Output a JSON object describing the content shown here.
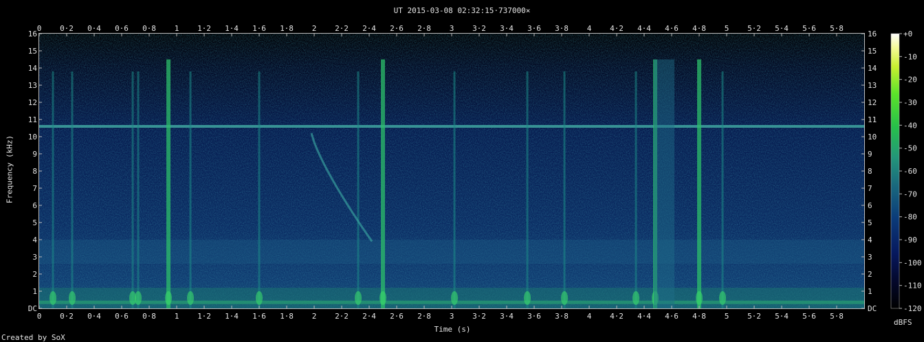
{
  "chart_data": {
    "type": "heatmap",
    "title": "UT 2015-03-08 02:32:15·737000×",
    "xlabel": "Time (s)",
    "ylabel": "Frequency (kHz)",
    "xlim": [
      0,
      6
    ],
    "ylim": [
      0,
      16
    ],
    "x_ticks": [
      "0",
      "0·2",
      "0·4",
      "0·6",
      "0·8",
      "1",
      "1·2",
      "1·4",
      "1·6",
      "1·8",
      "2",
      "2·2",
      "2·4",
      "2·6",
      "2·8",
      "3",
      "3·2",
      "3·4",
      "3·6",
      "3·8",
      "4",
      "4·2",
      "4·4",
      "4·6",
      "4·8",
      "5",
      "5·2",
      "5·4",
      "5·6",
      "5·8"
    ],
    "y_ticks": [
      "DC",
      "1",
      "2",
      "3",
      "4",
      "5",
      "6",
      "7",
      "8",
      "9",
      "10",
      "11",
      "12",
      "13",
      "14",
      "15",
      "16"
    ],
    "colorbar": {
      "label": "dBFS",
      "ticks": [
        "+0",
        "-10",
        "-20",
        "-30",
        "-40",
        "-50",
        "-60",
        "-70",
        "-80",
        "-90",
        "-100",
        "-110",
        "-120"
      ],
      "range": [
        -120,
        0
      ]
    },
    "features": {
      "tone_khz": 10.6,
      "transients_s": [
        0.1,
        0.24,
        0.68,
        0.72,
        0.94,
        1.1,
        1.6,
        2.32,
        2.5,
        3.02,
        3.55,
        3.82,
        4.34,
        4.48,
        4.8,
        4.97
      ]
    }
  },
  "credit": "Created by SoX"
}
